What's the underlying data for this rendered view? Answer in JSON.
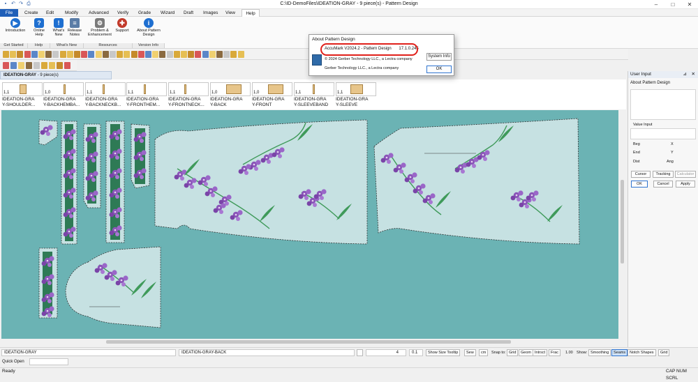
{
  "window": {
    "title": "C:\\ID-DemoFiles\\IDEATION-GRAY - 9 piece(s) - Pattern Design",
    "controls": [
      "–",
      "□",
      "✕"
    ]
  },
  "quick_access": [
    "save-icon",
    "undo-icon",
    "redo-icon",
    "print-icon"
  ],
  "menu": [
    "File",
    "Create",
    "Edit",
    "Modify",
    "Advanced",
    "Verify",
    "Grade",
    "Wizard",
    "Draft",
    "Images",
    "View",
    "Help"
  ],
  "active_menu": "Help",
  "ribbon": {
    "buttons": [
      {
        "label": "Introduction",
        "icon": "play-icon",
        "color": "#1e6fd0"
      },
      {
        "label": "Online Help",
        "icon": "help-icon",
        "color": "#1e6fd0"
      },
      {
        "label": "What's New",
        "icon": "whats-new-icon",
        "color": "#1e6fd0"
      },
      {
        "label": "Release Notes",
        "icon": "release-notes-icon",
        "color": "#5a7ca6"
      },
      {
        "label": "Problem & Enhancement",
        "icon": "problem-icon",
        "color": "#7a7a7a"
      },
      {
        "label": "Support",
        "icon": "support-icon",
        "color": "#c23a2b"
      },
      {
        "label": "About Pattern Design",
        "icon": "info-icon",
        "color": "#1e6fd0"
      }
    ],
    "groups": [
      "Get Started",
      "Help",
      "What's New",
      "Resources",
      "Version Info"
    ]
  },
  "doc_tab": {
    "name": "IDEATION-GRAY",
    "pieces": "9 piece(s)"
  },
  "pieces": [
    {
      "qty": "1,1",
      "name_1": "IDEATION-GRA",
      "name_2": "Y-SHOULDER..."
    },
    {
      "qty": "1,0",
      "name_1": "IDEATION-GRA",
      "name_2": "Y-BACKHEMBA..."
    },
    {
      "qty": "1,1",
      "name_1": "IDEATION-GRA",
      "name_2": "Y-BACKNECKB..."
    },
    {
      "qty": "1,1",
      "name_1": "IDEATION-GRA",
      "name_2": "Y-FRONTHEM..."
    },
    {
      "qty": "1,1",
      "name_1": "IDEATION-GRA",
      "name_2": "Y-FRONTNECK..."
    },
    {
      "qty": "1,0",
      "name_1": "IDEATION-GRA",
      "name_2": "Y-BACK"
    },
    {
      "qty": "1,0",
      "name_1": "IDEATION-GRA",
      "name_2": "Y-FRONT"
    },
    {
      "qty": "1,1",
      "name_1": "IDEATION-GRA",
      "name_2": "Y-SLEEVEBAND"
    },
    {
      "qty": "1,1",
      "name_1": "IDEATION-GRA",
      "name_2": "Y-SLEEVE"
    }
  ],
  "dialog": {
    "title": "About Pattern Design",
    "product": "AccuMark V2024.2 - Pattern Design",
    "version": "17.1.0.245",
    "copyright": "© 2024 Gerber Technology LLC., a Lectra company",
    "company": "Gerber Technology LLC., a Lectra company",
    "system_info_label": "System Info",
    "ok_label": "OK",
    "highlight_color": "#e0201a"
  },
  "user_input": {
    "title": "User Input",
    "prompt": "About Pattern Design",
    "value_input_label": "Value Input",
    "fields": [
      {
        "label": "Beg",
        "axis": "X"
      },
      {
        "label": "End",
        "axis": "Y"
      },
      {
        "label": "Dist",
        "axis": "Ang"
      }
    ],
    "tool_tabs": [
      "Cursor",
      "Tracking",
      "Calculator"
    ],
    "actions": [
      "OK",
      "Cancel",
      "Apply"
    ]
  },
  "status_row": {
    "model_name": "IDEATION-GRAY",
    "piece_name": "IDEATION-GRAY-BACK",
    "grade_value": "4",
    "precision": "0.1",
    "show_size_tooltip": "Show Size Tooltip",
    "units": [
      "Sew",
      "cm"
    ],
    "snap_to_label": "Snap to:",
    "snap_options": [
      "Grid",
      "Geom",
      "Intrsct",
      "Frac"
    ],
    "frac_value": "1.00",
    "show_label": "Show:",
    "show_options": [
      "Smoothing",
      "Seams",
      "Notch Shapes",
      "Grid"
    ],
    "active_show": "Seams"
  },
  "quick_open": {
    "label": "Quick Open",
    "value": ""
  },
  "statusbar": {
    "status": "Ready",
    "indicators": "CAP NUM SCRL"
  },
  "colors": {
    "canvas": "#6bb3b4",
    "piece_fill": "#c6e1e2",
    "flower": "#8a55b8",
    "leaf": "#3f9a5a"
  }
}
